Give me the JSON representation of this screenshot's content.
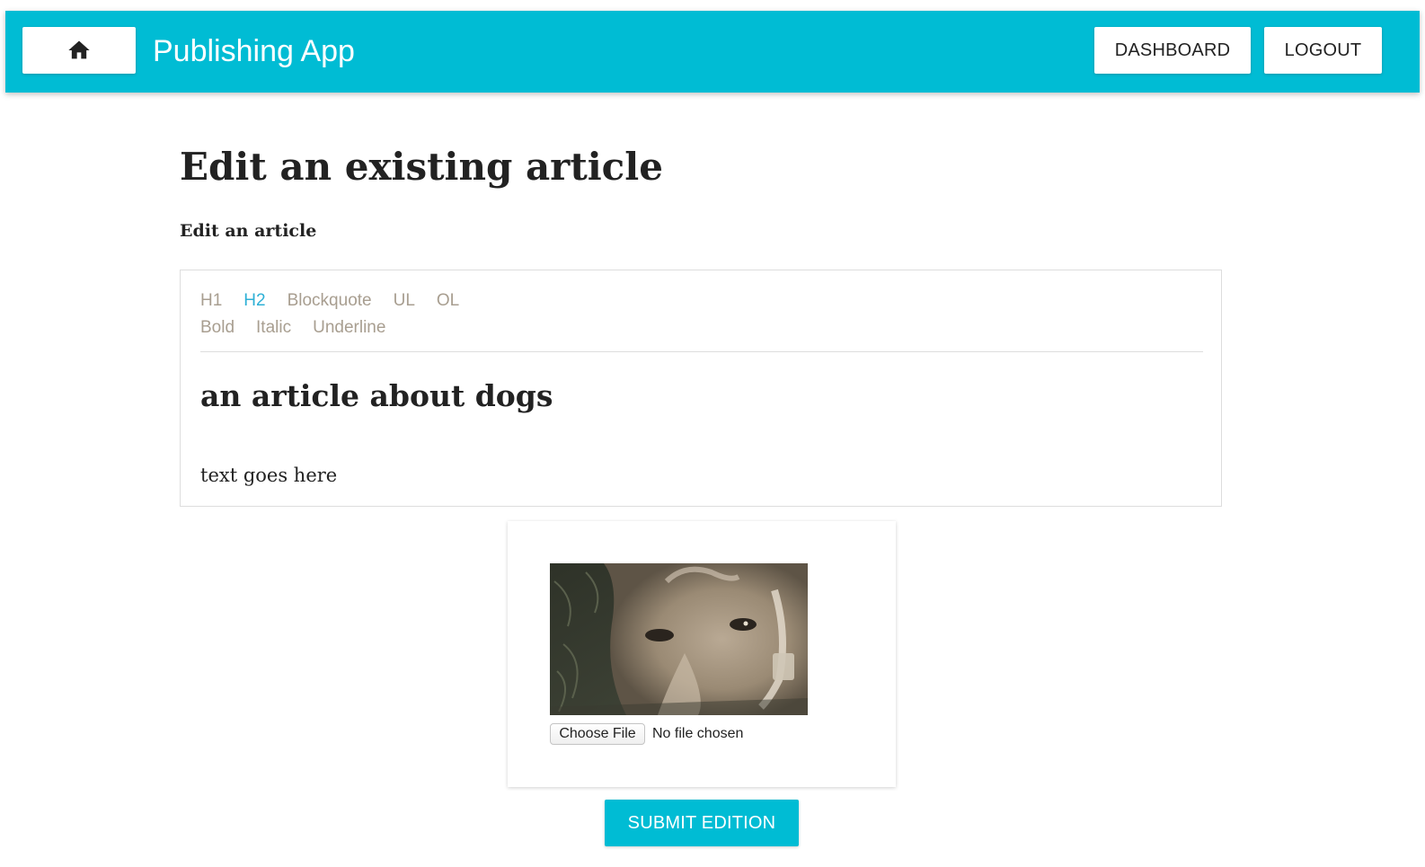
{
  "theme": {
    "accent": "#00bcd4",
    "active_tool": "#2eb0d6",
    "tool_text": "#a89e90",
    "text": "#222222"
  },
  "appbar": {
    "home_icon": "home-icon",
    "title": "Publishing App",
    "dashboard_label": "DASHBOARD",
    "logout_label": "LOGOUT"
  },
  "page": {
    "title": "Edit an existing article",
    "subtitle": "Edit an article"
  },
  "editor": {
    "toolbar_row1": [
      {
        "label": "H1",
        "active": false
      },
      {
        "label": "H2",
        "active": true
      },
      {
        "label": "Blockquote",
        "active": false
      },
      {
        "label": "UL",
        "active": false
      },
      {
        "label": "OL",
        "active": false
      }
    ],
    "toolbar_row2": [
      {
        "label": "Bold",
        "active": false
      },
      {
        "label": "Italic",
        "active": false
      },
      {
        "label": "Underline",
        "active": false
      }
    ],
    "heading": "an article about dogs",
    "body": "text goes here"
  },
  "image_upload": {
    "image_subject": "dog-photo",
    "choose_file_label": "Choose File",
    "file_status": "No file chosen"
  },
  "submit_label": "SUBMIT EDITION"
}
